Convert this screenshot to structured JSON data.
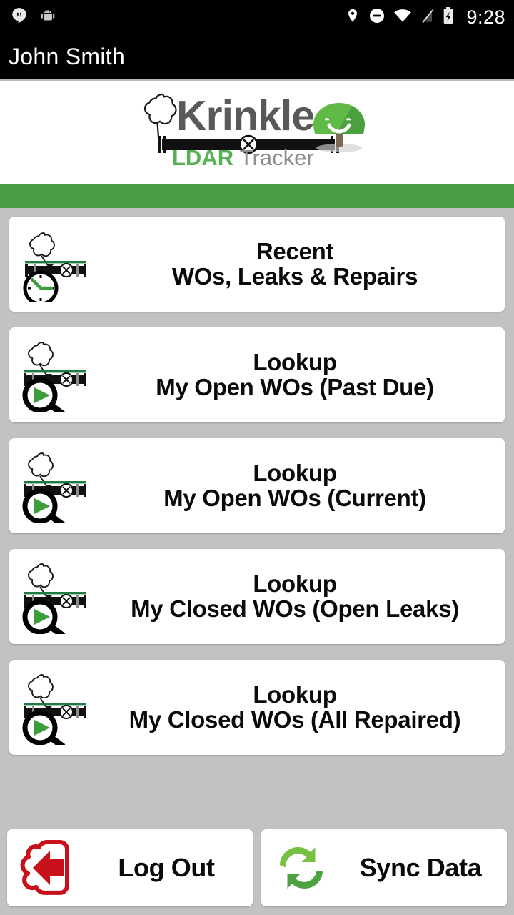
{
  "status_bar": {
    "time": "9:28",
    "left_icons": [
      "hangouts-icon",
      "android-icon"
    ],
    "right_icons": [
      "location-pin-icon",
      "do-not-disturb-icon",
      "wifi-icon",
      "signal-icon",
      "battery-charging-icon"
    ]
  },
  "app_bar": {
    "title": "John  Smith"
  },
  "logo": {
    "name": "Krinkle",
    "sub_primary": "LDAR",
    "sub_secondary": "Tracker",
    "icons": [
      "leak-cloud-icon",
      "pipe-valve-icon",
      "tree-icon"
    ]
  },
  "colors": {
    "brand_green": "#4a9e48",
    "logo_green": "#56b152",
    "logo_gray": "#595959",
    "background_gray": "#c2c2c2",
    "card_white": "#ffffff",
    "logout_red": "#c8101a",
    "sync_green_light": "#76c043",
    "sync_green_dark": "#4ca23f"
  },
  "menu": {
    "cards": [
      {
        "icon": "leak-clock-icon",
        "line1": "Recent",
        "line2": "WOs, Leaks & Repairs"
      },
      {
        "icon": "leak-search-icon",
        "line1": "Lookup",
        "line2": "My Open WOs (Past Due)"
      },
      {
        "icon": "leak-search-icon",
        "line1": "Lookup",
        "line2": "My Open WOs (Current)"
      },
      {
        "icon": "leak-search-icon",
        "line1": "Lookup",
        "line2": "My Closed WOs (Open Leaks)"
      },
      {
        "icon": "leak-search-icon",
        "line1": "Lookup",
        "line2": "My Closed WOs (All Repaired)"
      }
    ]
  },
  "bottom_bar": {
    "buttons": [
      {
        "icon": "logout-cloud-arrow-icon",
        "label": "Log Out"
      },
      {
        "icon": "sync-refresh-icon",
        "label": "Sync Data"
      }
    ]
  }
}
